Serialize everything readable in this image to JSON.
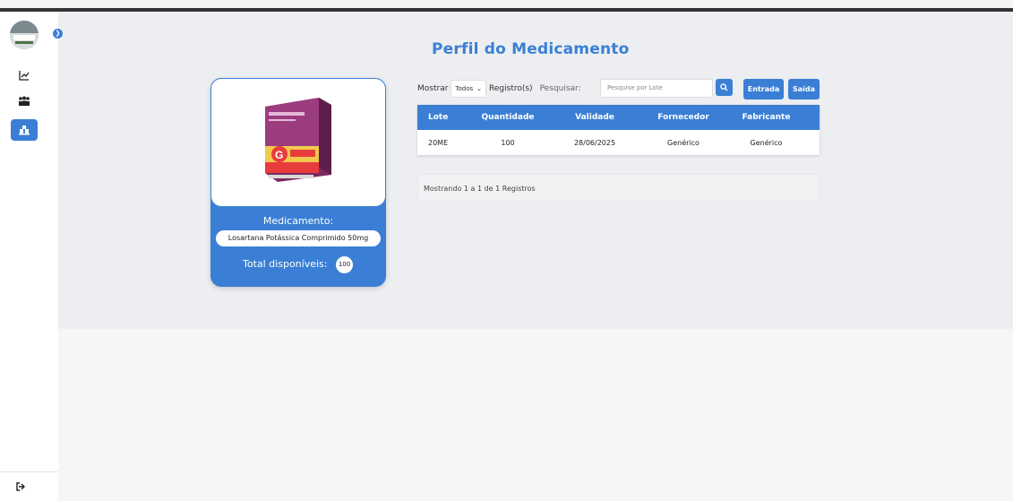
{
  "page": {
    "title": "Perfil do Medicamento"
  },
  "sidebar": {
    "expand_icon": "chevron-right-icon",
    "items": [
      {
        "icon": "chart-line-icon",
        "active": false
      },
      {
        "icon": "people-icon",
        "active": false
      },
      {
        "icon": "boxes-icon",
        "active": true
      }
    ],
    "logout_icon": "logout-icon"
  },
  "medicine": {
    "label": "Medicamento:",
    "name": "Losartana Potássica Comprimido 50mg",
    "total_label": "Total disponíveis:",
    "total": "100"
  },
  "controls": {
    "show_label": "Mostrar",
    "show_selected": "Todos",
    "records_label": "Registro(s)",
    "search_label": "Pesquisar:",
    "search_placeholder": "Pesquise por Lote",
    "entrada": "Entrada",
    "saida": "Saída"
  },
  "table": {
    "headers": [
      "Lote",
      "Quantidade",
      "Validade",
      "Fornecedor",
      "Fabricante"
    ],
    "rows": [
      [
        "20ME",
        "100",
        "28/06/2025",
        "Genérico",
        "Genérico"
      ]
    ]
  },
  "footer": {
    "info": "Mostrando 1 a 1 de 1 Registros"
  },
  "colors": {
    "primary": "#3a7fd5",
    "background": "#eceef1"
  }
}
